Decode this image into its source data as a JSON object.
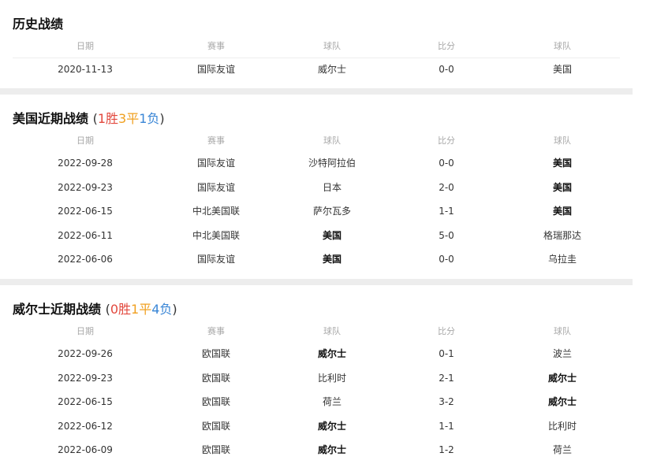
{
  "headers": [
    "日期",
    "赛事",
    "球队",
    "比分",
    "球队"
  ],
  "history": {
    "title": "历史战绩",
    "rows": [
      {
        "date": "2020-11-13",
        "comp": "国际友谊",
        "home": "威尔士",
        "score": "0-0",
        "away": "美国",
        "bold": ""
      }
    ]
  },
  "usa": {
    "title": "美国近期战绩",
    "record": {
      "open": "(",
      "w": "1胜",
      "d": "3平",
      "l": "1负",
      "close": ")"
    },
    "rows": [
      {
        "date": "2022-09-28",
        "comp": "国际友谊",
        "home": "沙特阿拉伯",
        "score": "0-0",
        "away": "美国",
        "bold": "away"
      },
      {
        "date": "2022-09-23",
        "comp": "国际友谊",
        "home": "日本",
        "score": "2-0",
        "away": "美国",
        "bold": "away"
      },
      {
        "date": "2022-06-15",
        "comp": "中北美国联",
        "home": "萨尔瓦多",
        "score": "1-1",
        "away": "美国",
        "bold": "away"
      },
      {
        "date": "2022-06-11",
        "comp": "中北美国联",
        "home": "美国",
        "score": "5-0",
        "away": "格瑞那达",
        "bold": "home"
      },
      {
        "date": "2022-06-06",
        "comp": "国际友谊",
        "home": "美国",
        "score": "0-0",
        "away": "乌拉圭",
        "bold": "home"
      }
    ]
  },
  "wales": {
    "title": "威尔士近期战绩",
    "record": {
      "open": "(",
      "w": "0胜",
      "d": "1平",
      "l": "4负",
      "close": ")"
    },
    "rows": [
      {
        "date": "2022-09-26",
        "comp": "欧国联",
        "home": "威尔士",
        "score": "0-1",
        "away": "波兰",
        "bold": "home"
      },
      {
        "date": "2022-09-23",
        "comp": "欧国联",
        "home": "比利时",
        "score": "2-1",
        "away": "威尔士",
        "bold": "away"
      },
      {
        "date": "2022-06-15",
        "comp": "欧国联",
        "home": "荷兰",
        "score": "3-2",
        "away": "威尔士",
        "bold": "away"
      },
      {
        "date": "2022-06-12",
        "comp": "欧国联",
        "home": "威尔士",
        "score": "1-1",
        "away": "比利时",
        "bold": "home"
      },
      {
        "date": "2022-06-09",
        "comp": "欧国联",
        "home": "威尔士",
        "score": "1-2",
        "away": "荷兰",
        "bold": "home"
      }
    ]
  },
  "colors": {
    "win": "#e2483d",
    "draw": "#f0a020",
    "loss": "#3a86d6",
    "header_text": "#a8a8a8",
    "divider": "#ededed"
  }
}
